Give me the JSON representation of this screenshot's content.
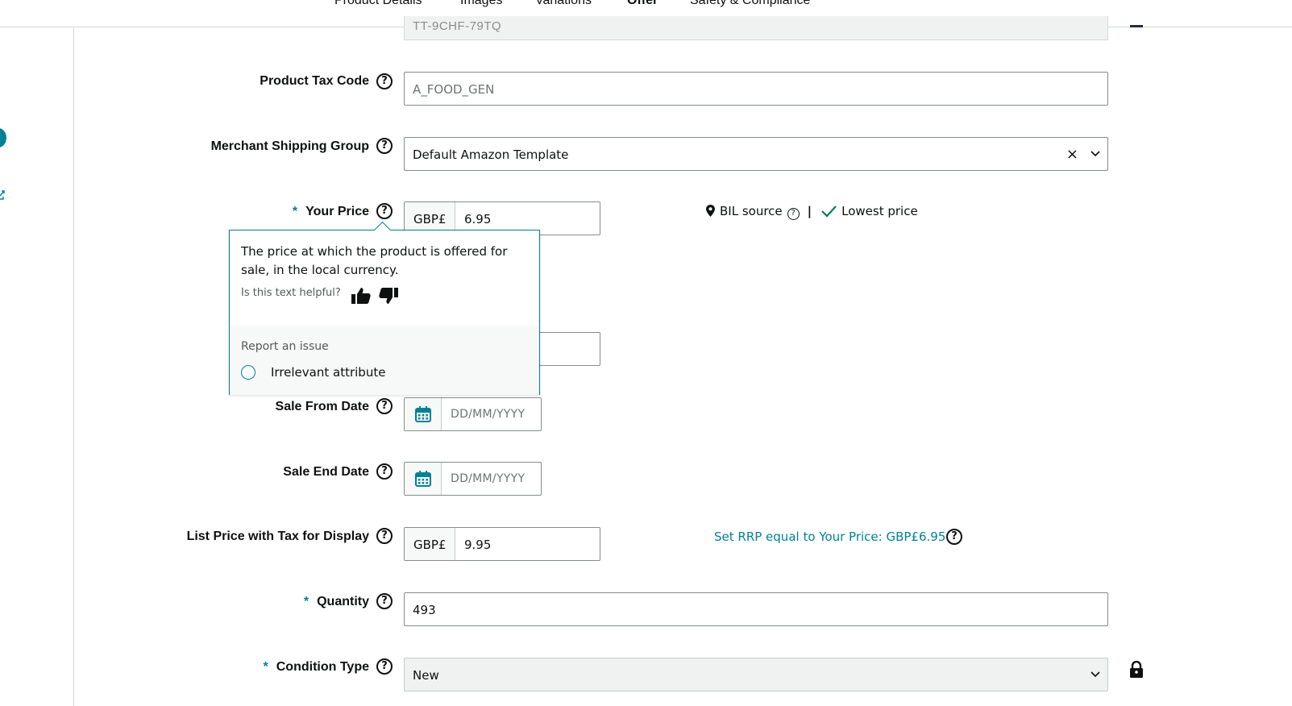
{
  "tabs": [
    {
      "label": "Product Details",
      "active": false
    },
    {
      "label": "Images",
      "active": false
    },
    {
      "label": "Variations",
      "active": false
    },
    {
      "label": "Offer",
      "active": true
    },
    {
      "label": "Safety & Compliance",
      "active": false
    }
  ],
  "top_field": {
    "value": "TT-9CHF-79TQ"
  },
  "product_tax_code": {
    "label": "Product Tax Code",
    "value": "A_FOOD_GEN"
  },
  "merchant_shipping_group": {
    "label": "Merchant Shipping Group",
    "value": "Default Amazon Template",
    "clear_icon": "×"
  },
  "your_price": {
    "label": "Your Price",
    "required_mark": "*",
    "currency": "GBP£",
    "value": "6.95"
  },
  "bil": {
    "source_label": "BIL source",
    "separator": "|",
    "status": "Lowest price"
  },
  "tooltip": {
    "text": "The price at which the product is offered for sale, in the local currency.",
    "helpful_prompt": "Is this text helpful?",
    "report_heading": "Report an issue",
    "option_label": "Irrelevant attribute"
  },
  "sale_from_date": {
    "label": "Sale From Date",
    "placeholder": "DD/MM/YYYY"
  },
  "sale_end_date": {
    "label": "Sale End Date",
    "placeholder": "DD/MM/YYYY"
  },
  "list_price": {
    "label": "List Price with Tax for Display",
    "currency": "GBP£",
    "value": "9.95",
    "rrp_link": "Set RRP equal to Your Price: GBP£6.95"
  },
  "quantity": {
    "label": "Quantity",
    "required_mark": "*",
    "value": "493"
  },
  "condition_type": {
    "label": "Condition Type",
    "required_mark": "*",
    "value": "New"
  },
  "help_glyph": "?",
  "colors": {
    "accent": "#008296",
    "text": "#0f1111",
    "border": "#888c8c",
    "readonly_bg": "#f0f2f2"
  }
}
